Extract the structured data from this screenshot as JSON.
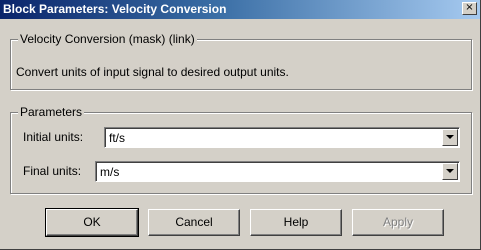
{
  "window": {
    "title": "Block Parameters: Velocity Conversion",
    "close_symbol": "×"
  },
  "mask_group": {
    "legend": "Velocity Conversion (mask) (link)",
    "description": "Convert units of input signal to desired output units."
  },
  "params_group": {
    "legend": "Parameters",
    "initial_label": "Initial units:",
    "initial_value": "ft/s",
    "final_label": "Final units:",
    "final_value": "m/s"
  },
  "buttons": {
    "ok": "OK",
    "cancel": "Cancel",
    "help": "Help",
    "apply": "Apply"
  },
  "icons": {
    "close": "close-icon",
    "dropdown": "chevron-down-icon"
  }
}
